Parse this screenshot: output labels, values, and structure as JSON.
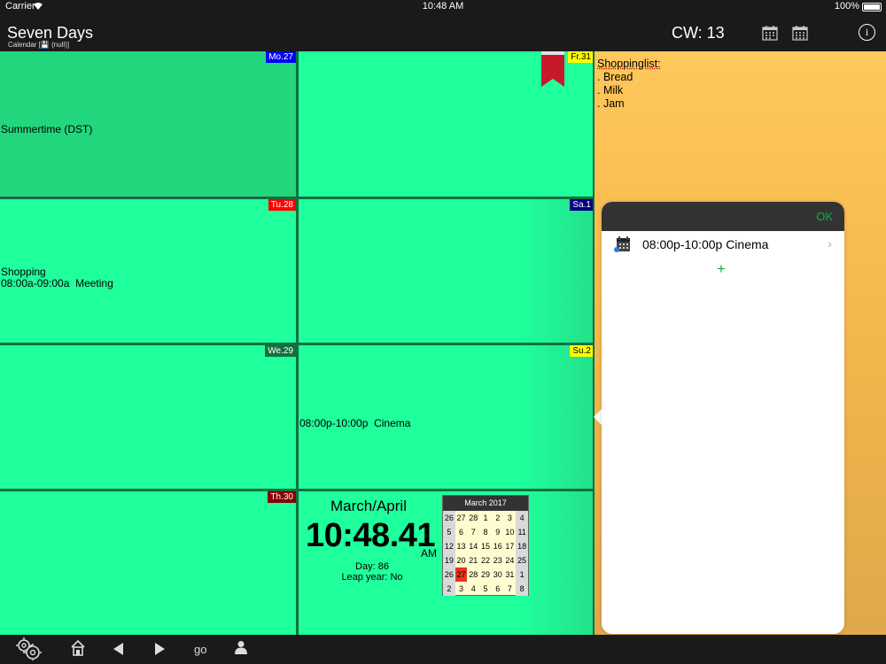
{
  "status_bar": {
    "carrier": "Carrier",
    "time": "10:48 AM",
    "battery": "100%"
  },
  "header": {
    "title": "Seven Days",
    "subtitle": "Calendar [💾 (null)]",
    "calendar_week": "CW: 13",
    "info_icon": "info-icon"
  },
  "days": {
    "mo": {
      "label": "Mo.27",
      "badge_bg": "#0000ff",
      "badge_fg": "#ffffff",
      "entries": "Summertime (DST)"
    },
    "tu": {
      "label": "Tu.28",
      "badge_bg": "#ff0000",
      "badge_fg": "#ffffff",
      "entries": "Shopping\n08:00a-09:00a  Meeting"
    },
    "we": {
      "label": "We.29",
      "badge_bg": "#15703f",
      "badge_fg": "#ffffff",
      "entries": ""
    },
    "th": {
      "label": "Th.30",
      "badge_bg": "#880000",
      "badge_fg": "#ffffff",
      "entries": ""
    },
    "fr": {
      "label": "Fr.31",
      "badge_bg": "#ffff00",
      "badge_fg": "#000000",
      "entries": ""
    },
    "sa": {
      "label": "Sa.1",
      "badge_bg": "#000080",
      "badge_fg": "#ffffff",
      "entries": ""
    },
    "su": {
      "label": "Su.2",
      "badge_bg": "#ffff00",
      "badge_fg": "#000000",
      "entries": "08:00p-10:00p  Cinema"
    }
  },
  "clock": {
    "month": "March/April",
    "time": "10:48.41",
    "ampm": "AM",
    "day": "Day: 86",
    "leap": "Leap year: No"
  },
  "mini_calendar": {
    "title": "March 2017",
    "today": "27",
    "rows": [
      [
        "26",
        "27",
        "28",
        "1",
        "2",
        "3",
        "4"
      ],
      [
        "5",
        "6",
        "7",
        "8",
        "9",
        "10",
        "11"
      ],
      [
        "12",
        "13",
        "14",
        "15",
        "16",
        "17",
        "18"
      ],
      [
        "19",
        "20",
        "21",
        "22",
        "23",
        "24",
        "25"
      ],
      [
        "26",
        "27",
        "28",
        "29",
        "30",
        "31",
        "1"
      ],
      [
        "2",
        "3",
        "4",
        "5",
        "6",
        "7",
        "8"
      ]
    ]
  },
  "note": {
    "heading": "Shoppinglist:",
    "lines": [
      ". Bread",
      ". Milk",
      ". Jam"
    ]
  },
  "popover": {
    "ok": "OK",
    "event": "08:00p-10:00p Cinema",
    "add": "+"
  },
  "toolbar": {
    "go": "go"
  },
  "colors": {
    "cell": "#1fff9c",
    "cell_dim": "#22d67e",
    "grid": "#106f40",
    "note": "#ffc85a",
    "accent": "#1aa84a"
  }
}
